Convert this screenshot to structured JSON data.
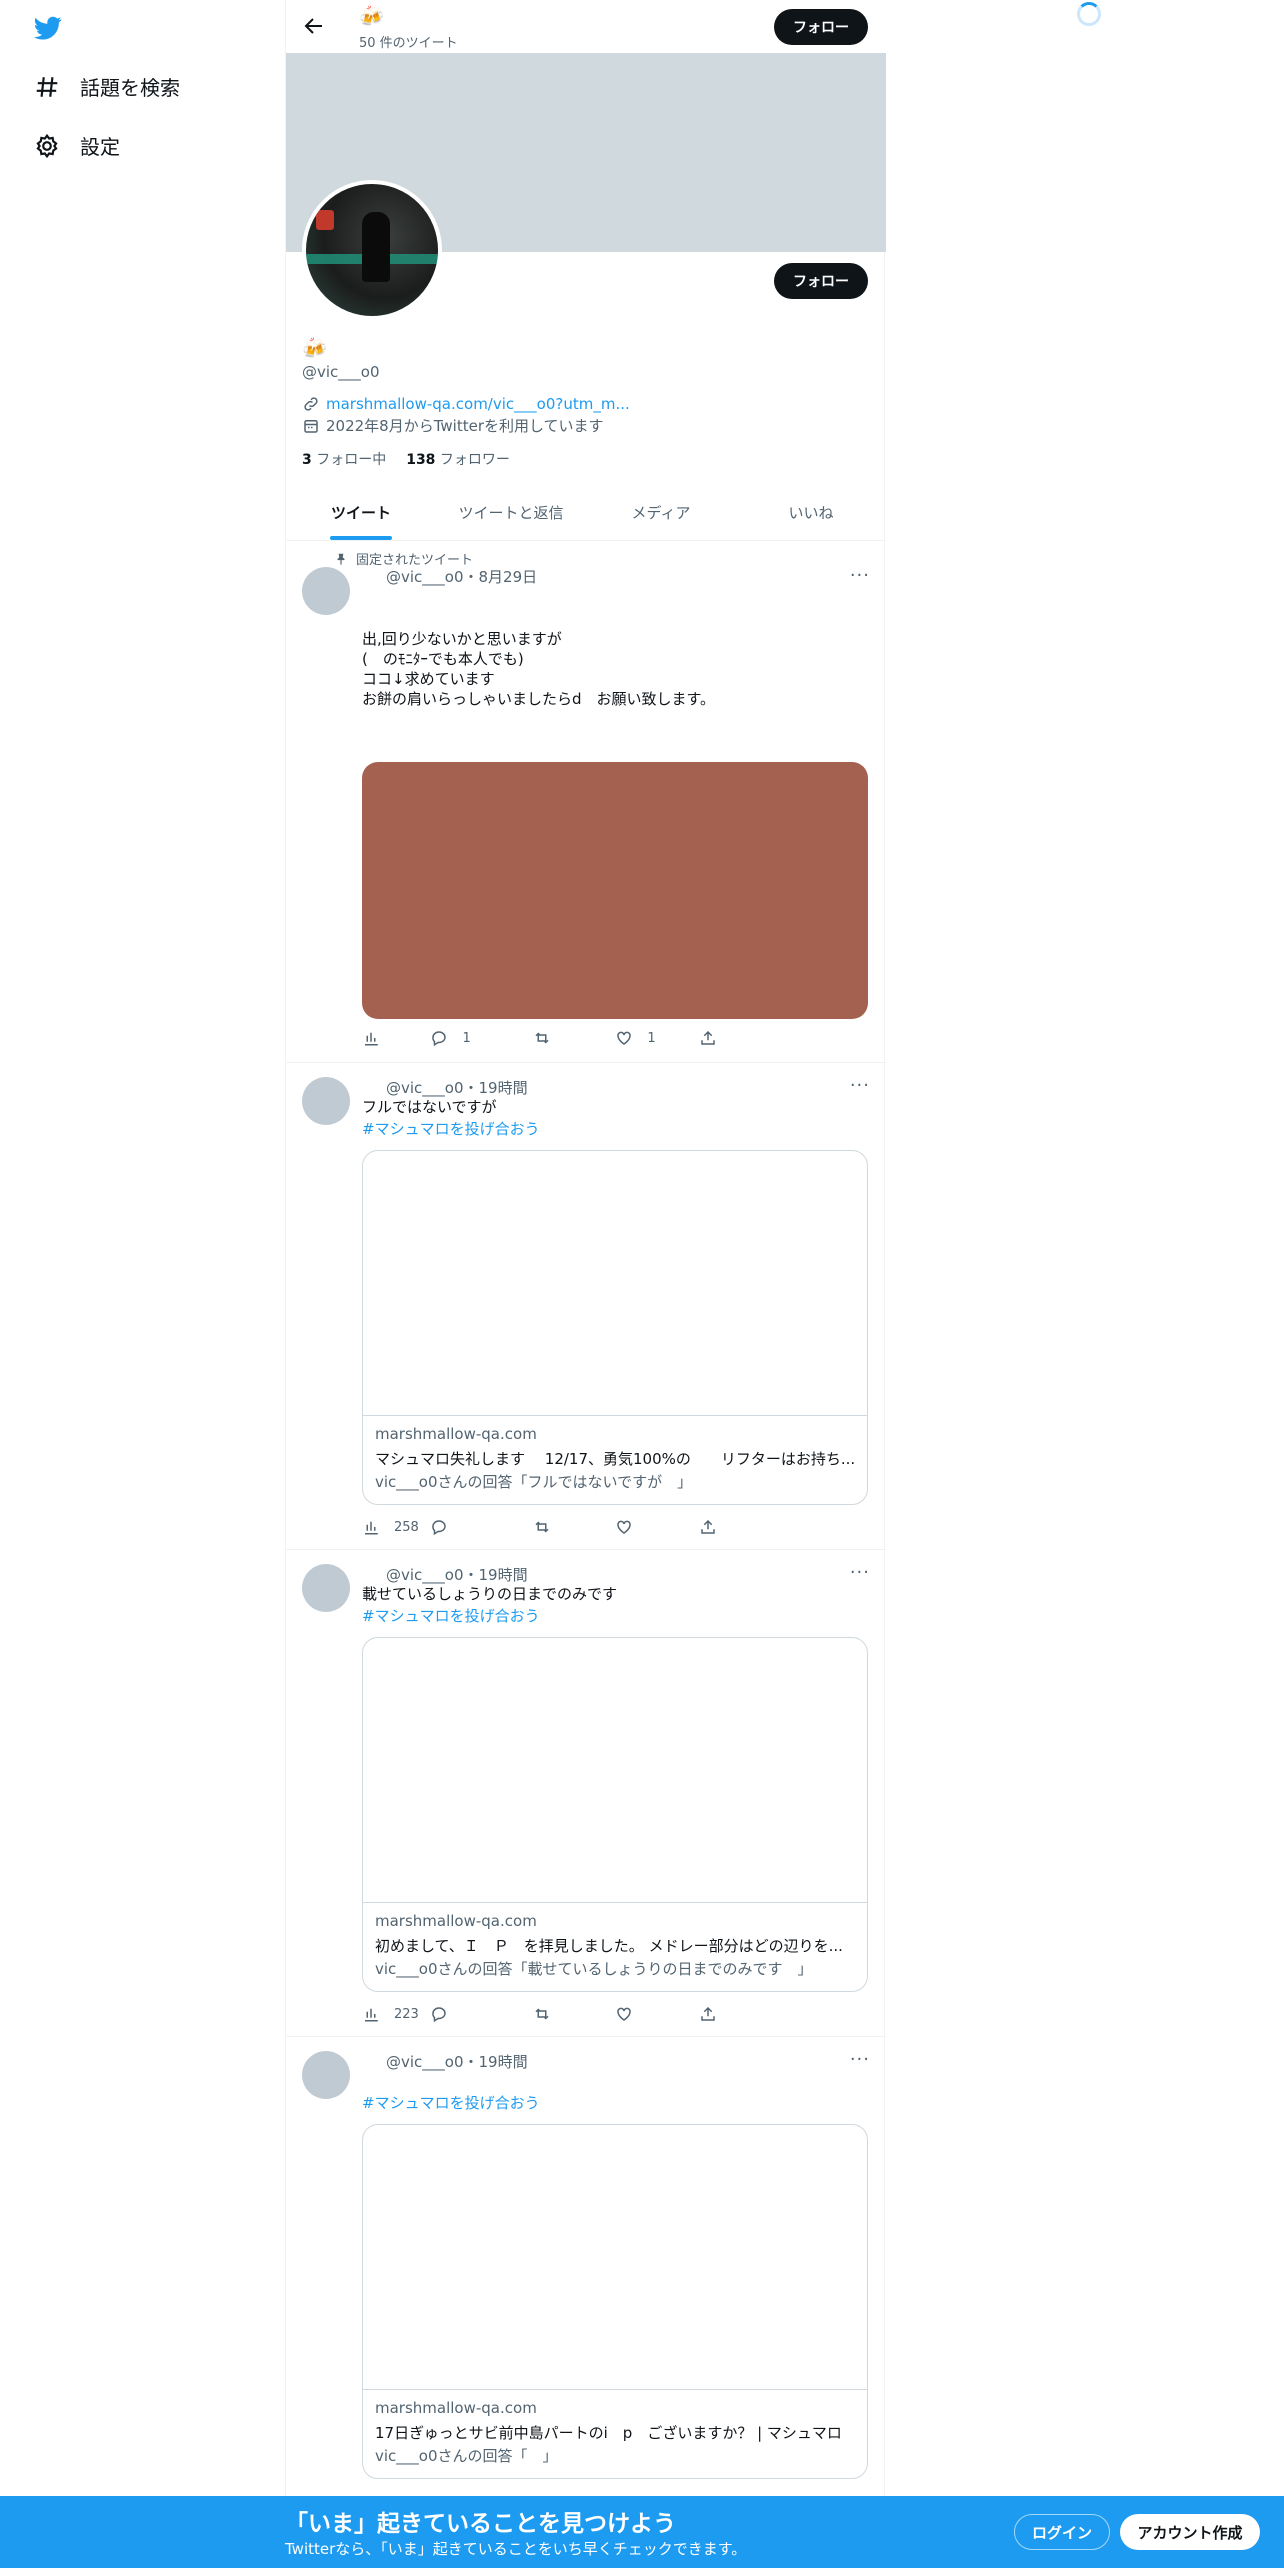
{
  "nav": {
    "explore_label": "話題を検索",
    "settings_label": "設定"
  },
  "header": {
    "emoji": "🍻",
    "tweet_count": "50 件のツイート",
    "follow_label": "フォロー"
  },
  "profile": {
    "emoji": "🍻",
    "handle": "@vic___o0",
    "follow_label": "フォロー",
    "link": "marshmallow-qa.com/vic___o0?utm_m...",
    "joined": "2022年8月からTwitterを利用しています",
    "following_count": "3",
    "following_label": "フォロー中",
    "followers_count": "138",
    "followers_label": "フォロワー"
  },
  "tabs": [
    "ツイート",
    "ツイートと返信",
    "メディア",
    "いいね"
  ],
  "tweets": [
    {
      "pinned_label": "固定されたツイート",
      "header": "@vic___o0・8月29日",
      "more": "···",
      "text": "出,回り少ないかと思いますが\n(　のﾓﾆﾀｰでも本人でも)\nココ↓求めています\nお餅の肩いらっしゃいましたらd　お願い致します。",
      "reply_count": "1",
      "like_count": "1"
    },
    {
      "header": "@vic___o0・19時間",
      "more": "···",
      "text": "フルではないですが",
      "hashtag": "#マシュマロを投げ合おう",
      "card_domain": "marshmallow-qa.com",
      "card_title": "マシュマロ失礼します　 12/17、勇気100%の　　リフターはお持ち...",
      "card_desc": "vic___o0さんの回答「フルではないですが　」",
      "view_count": "258"
    },
    {
      "header": "@vic___o0・19時間",
      "more": "···",
      "text": "載せているしょうりの日までのみです",
      "hashtag": "#マシュマロを投げ合おう",
      "card_domain": "marshmallow-qa.com",
      "card_title": "初めまして、Ｉ　Ｐ　を拝見しました。 メドレー部分はどの辺りを...",
      "card_desc": "vic___o0さんの回答「載せているしょうりの日までのみです　」",
      "view_count": "223"
    },
    {
      "header": "@vic___o0・19時間",
      "more": "···",
      "hashtag": "#マシュマロを投げ合おう",
      "card_domain": "marshmallow-qa.com",
      "card_title": "17日ぎゅっとサビ前中島パートのi　p　ございますか？ | マシュマロ",
      "card_desc": "vic___o0さんの回答「　」"
    }
  ],
  "bottom_bar": {
    "title": "「いま」起きていることを見つけよう",
    "subtitle": "Twitterなら、「いま」起きていることをいち早くチェックできます。",
    "login_label": "ログイン",
    "signup_label": "アカウント作成"
  },
  "colors": {
    "accent": "#1d9bf0",
    "dark": "#0f1419",
    "muted": "#536471",
    "banner": "#cfd9de",
    "media": "#a5614f"
  }
}
